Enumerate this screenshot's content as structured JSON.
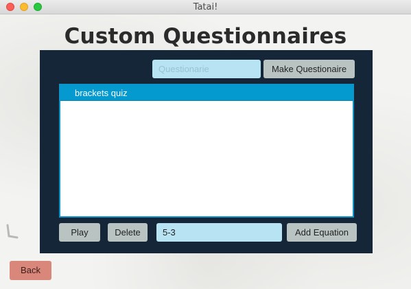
{
  "window": {
    "title": "Tatai!"
  },
  "page": {
    "title": "Custom Questionnaires"
  },
  "top_bar": {
    "name_placeholder": "Questionarie",
    "name_value": "",
    "make_button_label": "Make Questionaire"
  },
  "questionnaires": {
    "items": [
      "brackets quiz"
    ],
    "selected_index": 0
  },
  "bottom_bar": {
    "play_label": "Play",
    "delete_label": "Delete",
    "equation_value": "5-3",
    "add_equation_label": "Add Equation"
  },
  "back_label": "Back",
  "colors": {
    "panel": "#152638",
    "input_bg": "#b7e3f2",
    "button_bg": "#b9c4c2",
    "selection": "#0499cf",
    "back_button": "#d9877a"
  }
}
